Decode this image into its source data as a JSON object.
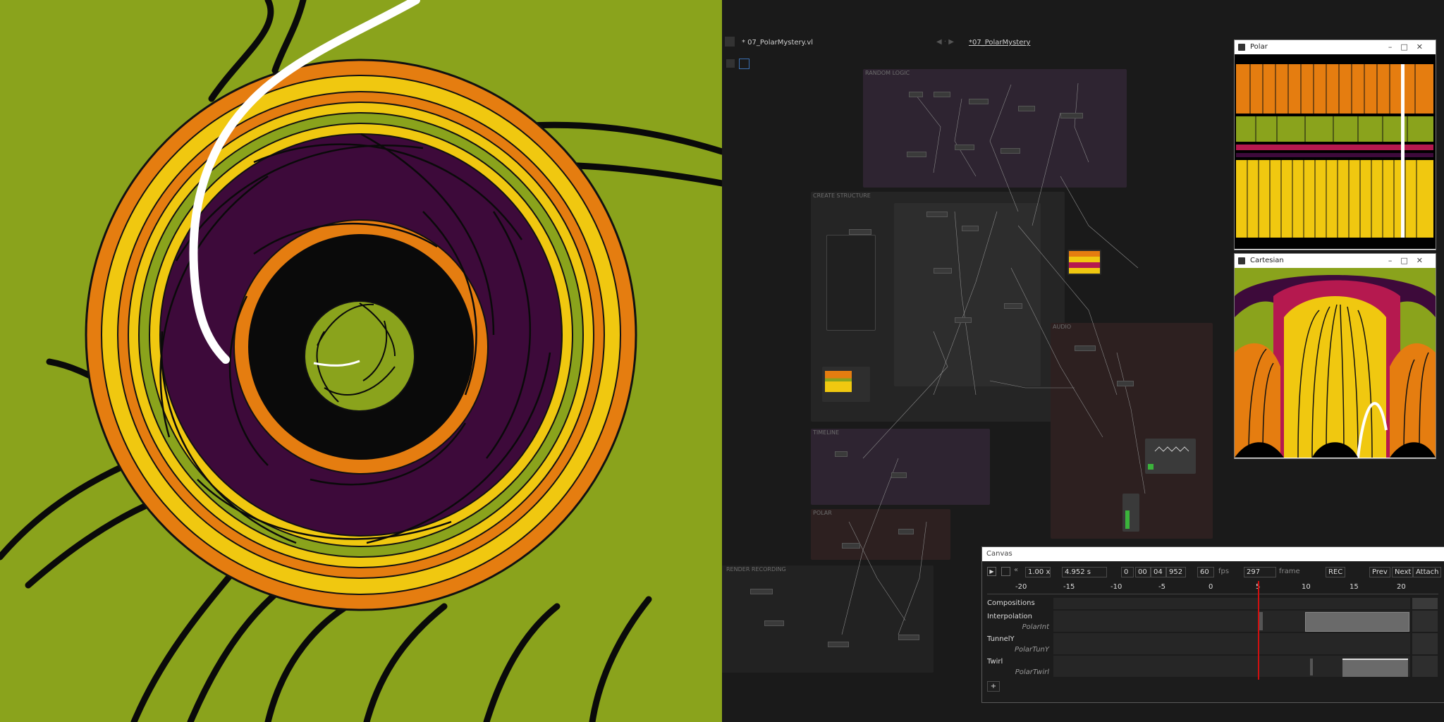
{
  "editor": {
    "file_tab": "* 07_PolarMystery.vl",
    "doc_tab": "*07_PolarMystery"
  },
  "regions": {
    "random_logic": "RANDOM LOGIC",
    "create_structure": "CREATE STRUCTURE",
    "timeline": "TIMELINE",
    "polar": "POLAR",
    "audio": "AUDIO",
    "render_recording": "RENDER RECORDING"
  },
  "windows": {
    "polar_title": "Polar",
    "cartesian_title": "Cartesian"
  },
  "timeline": {
    "window_title": "Canvas",
    "speed": "1.00 x",
    "time_seconds": "4.952 s",
    "time_fields": [
      "0",
      "00",
      "04",
      "952"
    ],
    "fps_value": "60",
    "fps_label": "fps",
    "frame_value": "297",
    "frame_label": "frame",
    "rec_label": "REC",
    "prev_label": "Prev",
    "next_label": "Next",
    "attach_label": "Attach",
    "ruler": [
      "-20",
      "-15",
      "-10",
      "-5",
      "0",
      "5",
      "10",
      "15",
      "20"
    ],
    "tracks": [
      {
        "name": "Compositions",
        "sub": ""
      },
      {
        "name": "Interpolation",
        "sub": "PolarInt"
      },
      {
        "name": "TunnelY",
        "sub": "PolarTunY"
      },
      {
        "name": "Twirl",
        "sub": "PolarTwirl"
      }
    ],
    "add_label": "+"
  },
  "colors": {
    "green": "#8aa31c",
    "orange": "#e57d10",
    "yellow": "#f0c810",
    "purple": "#3d0a3a",
    "crimson": "#b5194f",
    "playhead": "#d01010"
  }
}
